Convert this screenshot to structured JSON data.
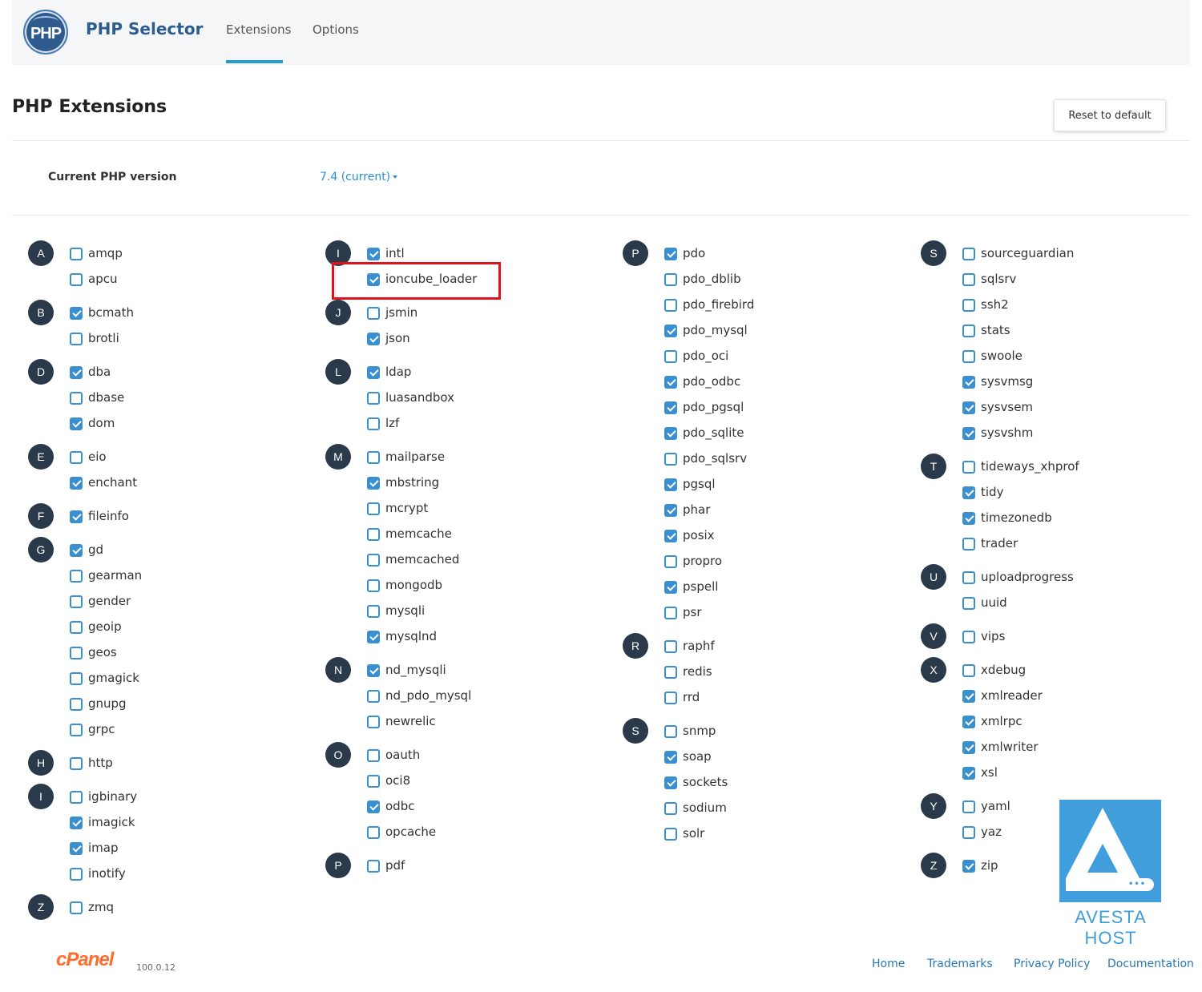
{
  "header": {
    "logo_text": "PHP",
    "title": "PHP Selector",
    "tabs": [
      {
        "label": "Extensions",
        "active": true
      },
      {
        "label": "Options",
        "active": false
      }
    ]
  },
  "page": {
    "title": "PHP Extensions",
    "reset_label": "Reset to default",
    "version_label": "Current PHP version",
    "version_value": "7.4 (current)"
  },
  "colors": {
    "accent": "#3a8fd0",
    "badge": "#2b3a4a",
    "highlight": "#e0121b",
    "brand_title": "#2d5d8e"
  },
  "columns": [
    [
      {
        "letter": "A",
        "items": [
          {
            "name": "amqp",
            "on": false
          },
          {
            "name": "apcu",
            "on": false
          }
        ]
      },
      {
        "letter": "B",
        "items": [
          {
            "name": "bcmath",
            "on": true
          },
          {
            "name": "brotli",
            "on": false
          }
        ]
      },
      {
        "letter": "D",
        "items": [
          {
            "name": "dba",
            "on": true
          },
          {
            "name": "dbase",
            "on": false
          },
          {
            "name": "dom",
            "on": true
          }
        ]
      },
      {
        "letter": "E",
        "items": [
          {
            "name": "eio",
            "on": false
          },
          {
            "name": "enchant",
            "on": true
          }
        ]
      },
      {
        "letter": "F",
        "items": [
          {
            "name": "fileinfo",
            "on": true
          }
        ]
      },
      {
        "letter": "G",
        "items": [
          {
            "name": "gd",
            "on": true
          },
          {
            "name": "gearman",
            "on": false
          },
          {
            "name": "gender",
            "on": false
          },
          {
            "name": "geoip",
            "on": false
          },
          {
            "name": "geos",
            "on": false
          },
          {
            "name": "gmagick",
            "on": false
          },
          {
            "name": "gnupg",
            "on": false
          },
          {
            "name": "grpc",
            "on": false
          }
        ]
      },
      {
        "letter": "H",
        "items": [
          {
            "name": "http",
            "on": false
          }
        ]
      },
      {
        "letter": "I",
        "items": [
          {
            "name": "igbinary",
            "on": false
          },
          {
            "name": "imagick",
            "on": true
          },
          {
            "name": "imap",
            "on": true
          },
          {
            "name": "inotify",
            "on": false
          }
        ]
      },
      {
        "letter": "Z",
        "items": [
          {
            "name": "zmq",
            "on": false
          }
        ]
      }
    ],
    [
      {
        "letter": "I",
        "items": [
          {
            "name": "intl",
            "on": true
          },
          {
            "name": "ioncube_loader",
            "on": true
          }
        ]
      },
      {
        "letter": "J",
        "items": [
          {
            "name": "jsmin",
            "on": false
          },
          {
            "name": "json",
            "on": true
          }
        ]
      },
      {
        "letter": "L",
        "items": [
          {
            "name": "ldap",
            "on": true
          },
          {
            "name": "luasandbox",
            "on": false
          },
          {
            "name": "lzf",
            "on": false
          }
        ]
      },
      {
        "letter": "M",
        "items": [
          {
            "name": "mailparse",
            "on": false
          },
          {
            "name": "mbstring",
            "on": true
          },
          {
            "name": "mcrypt",
            "on": false
          },
          {
            "name": "memcache",
            "on": false
          },
          {
            "name": "memcached",
            "on": false
          },
          {
            "name": "mongodb",
            "on": false
          },
          {
            "name": "mysqli",
            "on": false
          },
          {
            "name": "mysqlnd",
            "on": true
          }
        ]
      },
      {
        "letter": "N",
        "items": [
          {
            "name": "nd_mysqli",
            "on": true
          },
          {
            "name": "nd_pdo_mysql",
            "on": false
          },
          {
            "name": "newrelic",
            "on": false
          }
        ]
      },
      {
        "letter": "O",
        "items": [
          {
            "name": "oauth",
            "on": false
          },
          {
            "name": "oci8",
            "on": false
          },
          {
            "name": "odbc",
            "on": true
          },
          {
            "name": "opcache",
            "on": false
          }
        ]
      },
      {
        "letter": "P",
        "items": [
          {
            "name": "pdf",
            "on": false
          }
        ]
      }
    ],
    [
      {
        "letter": "P",
        "items": [
          {
            "name": "pdo",
            "on": true
          },
          {
            "name": "pdo_dblib",
            "on": false
          },
          {
            "name": "pdo_firebird",
            "on": false
          },
          {
            "name": "pdo_mysql",
            "on": true
          },
          {
            "name": "pdo_oci",
            "on": false
          },
          {
            "name": "pdo_odbc",
            "on": true
          },
          {
            "name": "pdo_pgsql",
            "on": true
          },
          {
            "name": "pdo_sqlite",
            "on": true
          },
          {
            "name": "pdo_sqlsrv",
            "on": false
          },
          {
            "name": "pgsql",
            "on": true
          },
          {
            "name": "phar",
            "on": true
          },
          {
            "name": "posix",
            "on": true
          },
          {
            "name": "propro",
            "on": false
          },
          {
            "name": "pspell",
            "on": true
          },
          {
            "name": "psr",
            "on": false
          }
        ]
      },
      {
        "letter": "R",
        "items": [
          {
            "name": "raphf",
            "on": false
          },
          {
            "name": "redis",
            "on": false
          },
          {
            "name": "rrd",
            "on": false
          }
        ]
      },
      {
        "letter": "S",
        "items": [
          {
            "name": "snmp",
            "on": false
          },
          {
            "name": "soap",
            "on": true
          },
          {
            "name": "sockets",
            "on": true
          },
          {
            "name": "sodium",
            "on": false
          },
          {
            "name": "solr",
            "on": false
          }
        ]
      }
    ],
    [
      {
        "letter": "S",
        "items": [
          {
            "name": "sourceguardian",
            "on": false
          },
          {
            "name": "sqlsrv",
            "on": false
          },
          {
            "name": "ssh2",
            "on": false
          },
          {
            "name": "stats",
            "on": false
          },
          {
            "name": "swoole",
            "on": false
          },
          {
            "name": "sysvmsg",
            "on": true
          },
          {
            "name": "sysvsem",
            "on": true
          },
          {
            "name": "sysvshm",
            "on": true
          }
        ]
      },
      {
        "letter": "T",
        "items": [
          {
            "name": "tideways_xhprof",
            "on": false
          },
          {
            "name": "tidy",
            "on": true
          },
          {
            "name": "timezonedb",
            "on": true
          },
          {
            "name": "trader",
            "on": false
          }
        ]
      },
      {
        "letter": "U",
        "items": [
          {
            "name": "uploadprogress",
            "on": false
          },
          {
            "name": "uuid",
            "on": false
          }
        ]
      },
      {
        "letter": "V",
        "items": [
          {
            "name": "vips",
            "on": false
          }
        ]
      },
      {
        "letter": "X",
        "items": [
          {
            "name": "xdebug",
            "on": false
          },
          {
            "name": "xmlreader",
            "on": true
          },
          {
            "name": "xmlrpc",
            "on": true
          },
          {
            "name": "xmlwriter",
            "on": true
          },
          {
            "name": "xsl",
            "on": true
          }
        ]
      },
      {
        "letter": "Y",
        "items": [
          {
            "name": "yaml",
            "on": false
          },
          {
            "name": "yaz",
            "on": false
          }
        ]
      },
      {
        "letter": "Z",
        "items": [
          {
            "name": "zip",
            "on": true
          }
        ]
      }
    ]
  ],
  "watermark": {
    "text": "AVESTA HOST",
    "icon": "avesta-host-logo"
  },
  "footer": {
    "brand": "cPanel",
    "version": "100.0.12",
    "links": [
      "Home",
      "Trademarks",
      "Privacy Policy",
      "Documentation"
    ]
  }
}
